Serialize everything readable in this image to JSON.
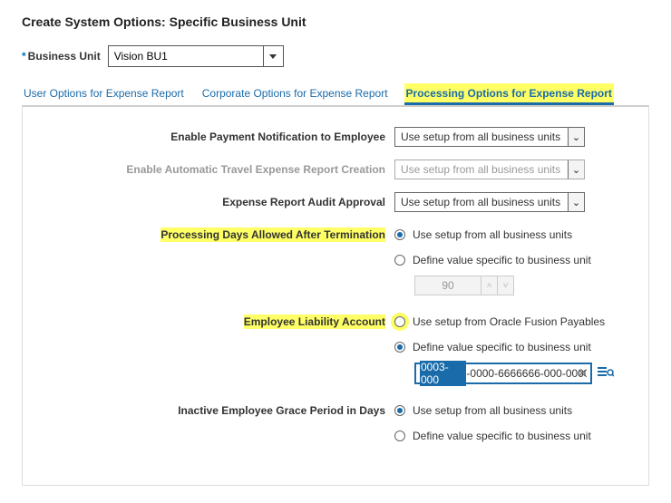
{
  "page_title": "Create System Options: Specific Business Unit",
  "business_unit": {
    "label": "Business Unit",
    "value": "Vision BU1"
  },
  "tabs": [
    {
      "label": "User Options for Expense Report"
    },
    {
      "label": "Corporate Options for Expense Report"
    },
    {
      "label": "Processing Options for Expense Report"
    }
  ],
  "opts": {
    "use_all_bu": "Use setup from all business units",
    "define_specific": "Define value specific to business unit",
    "use_payables": "Use setup from Oracle Fusion Payables"
  },
  "rows": {
    "payment_notif": {
      "label": "Enable Payment Notification to Employee",
      "value": "Use setup from all business units"
    },
    "auto_travel": {
      "label": "Enable Automatic Travel Expense Report Creation",
      "value": "Use setup from all business units"
    },
    "audit_approval": {
      "label": "Expense Report Audit Approval",
      "value": "Use setup from all business units"
    },
    "proc_days": {
      "label": "Processing Days Allowed After Termination",
      "spinner_value": "90"
    },
    "liability": {
      "label": "Employee Liability Account",
      "account_selected": "0003-000",
      "account_rest": "-0000-6666666-000-0000"
    },
    "inactive_grace": {
      "label": "Inactive Employee Grace Period in Days"
    }
  }
}
